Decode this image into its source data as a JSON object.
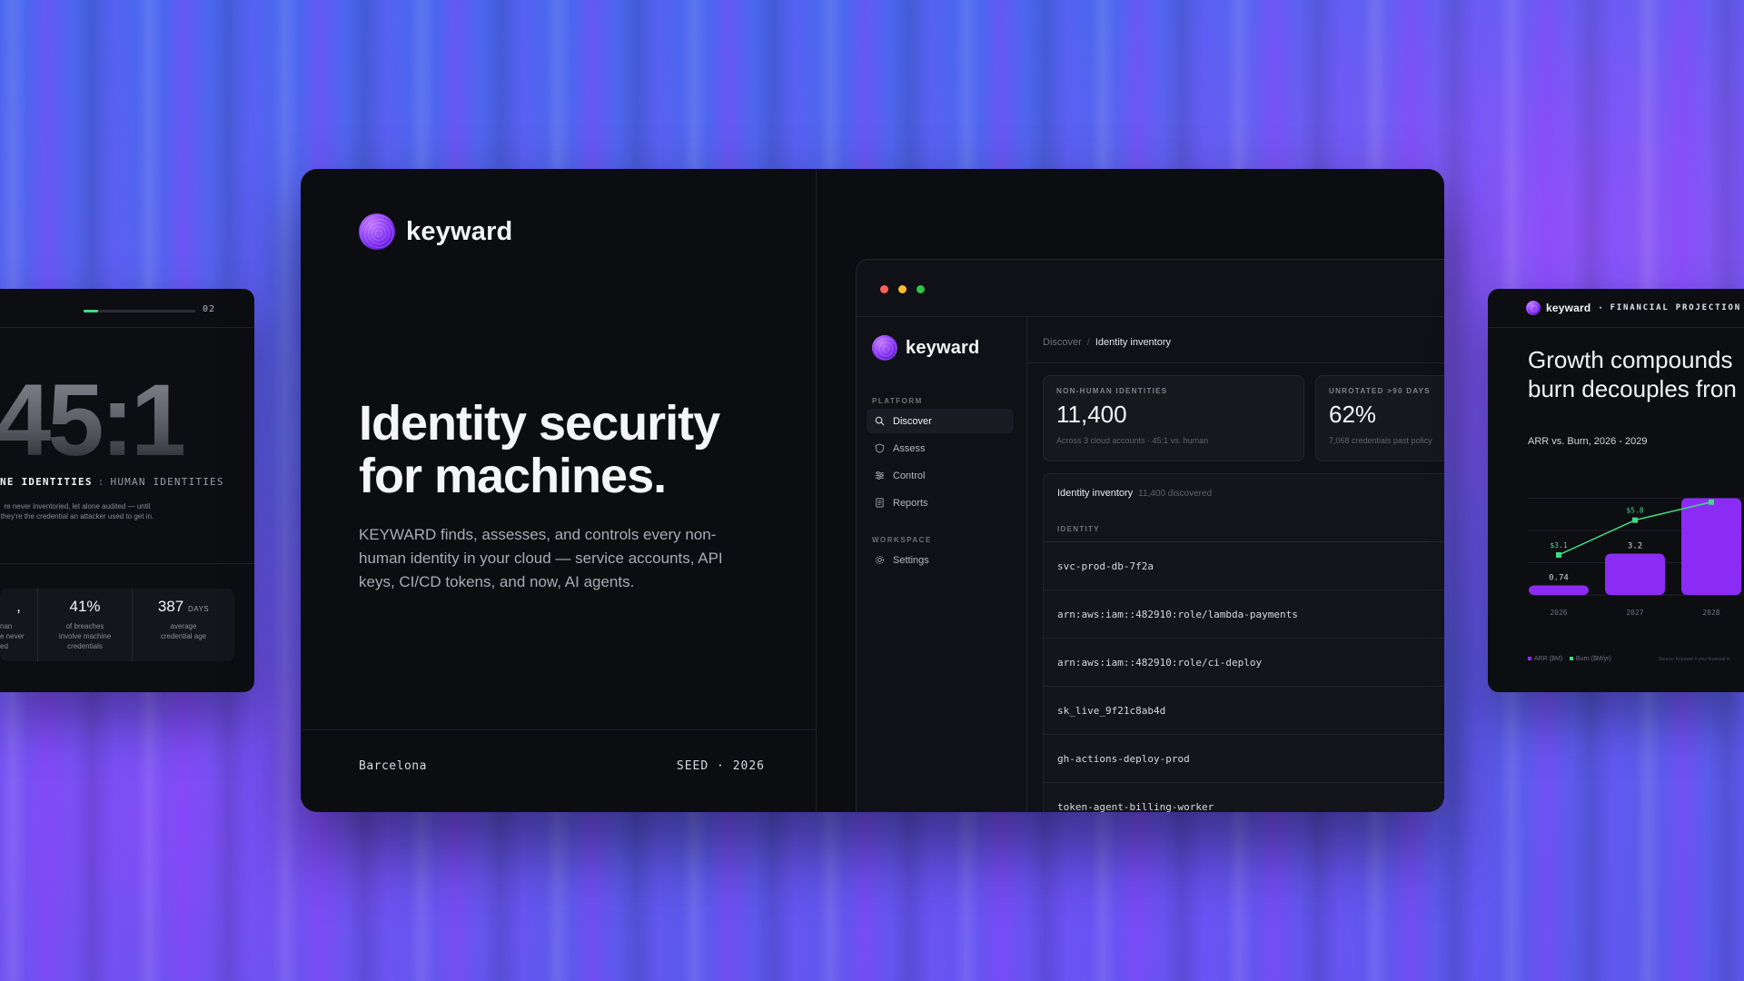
{
  "left_card": {
    "page": "02",
    "progress": 0.13,
    "ratio": "45:1",
    "label_a": "NE IDENTITIES",
    "label_sep": ":",
    "label_b": "HUMAN IDENTITIES",
    "description": "re never inventoried, let alone audited — until they're the credential an attacker used to get in.",
    "stats": [
      {
        "value": ",",
        "unit": "",
        "desc": "nan\ne never\ned"
      },
      {
        "value": "41%",
        "unit": "",
        "desc": "of breaches\ninvolve machine\ncredentials"
      },
      {
        "value": "387",
        "unit": "DAYS",
        "desc": "average\ncredential age"
      }
    ]
  },
  "main": {
    "brand": "keyward",
    "hero_title": "Identity security for machines.",
    "hero_sub": "KEYWARD finds, assesses, and controls every non-human identity in your cloud — service accounts, API keys, CI/CD tokens, and now, AI agents.",
    "footer_city": "Barcelona",
    "footer_seed": "SEED · 2026"
  },
  "app": {
    "window_dots": [
      "#ff5f57",
      "#febc2e",
      "#28c840"
    ],
    "brand": "keyward",
    "sections": {
      "platform": "PLATFORM",
      "workspace": "WORKSPACE"
    },
    "nav": [
      {
        "label": "Discover",
        "icon": "search-icon",
        "active": true
      },
      {
        "label": "Assess",
        "icon": "shield-icon",
        "active": false
      },
      {
        "label": "Control",
        "icon": "sliders-icon",
        "active": false
      },
      {
        "label": "Reports",
        "icon": "document-icon",
        "active": false
      }
    ],
    "settings": {
      "label": "Settings",
      "icon": "gear-icon"
    },
    "breadcrumb": {
      "parent": "Discover",
      "current": "Identity inventory"
    },
    "kpis": [
      {
        "label": "NON-HUMAN IDENTITIES",
        "value": "11,400",
        "note": "Across 3 cloud accounts · 45:1 vs. human"
      },
      {
        "label": "UNROTATED >90 DAYS",
        "value": "62%",
        "note": "7,068 credentials past policy"
      }
    ],
    "table": {
      "title": "Identity inventory",
      "count": "11,400 discovered",
      "column": "IDENTITY",
      "rows": [
        "svc-prod-db-7f2a",
        "arn:aws:iam::482910:role/lambda-payments",
        "arn:aws:iam::482910:role/ci-deploy",
        "sk_live_9f21c8ab4d",
        "gh-actions-deploy-prod",
        "token-agent-billing-worker"
      ]
    }
  },
  "right_card": {
    "brand": "keyward",
    "bullet": "•",
    "header_label": "FINANCIAL PROJECTION",
    "title_line1": "Growth compounds",
    "title_line2": "burn decouples fron",
    "legend_arr": "ARR ($M)",
    "legend_burn": "Burn ($M/yr)",
    "source": "Source: Keyward # your financial m",
    "colors": {
      "arr": "#8b2cf5",
      "burn": "#3ddc84"
    }
  },
  "chart_data": {
    "type": "bar",
    "title": "ARR vs. Burn, 2026 - 2029",
    "categories": [
      "2026",
      "2027",
      "2028"
    ],
    "series": [
      {
        "name": "ARR ($M)",
        "type": "bar",
        "values": [
          0.74,
          3.2,
          7.5
        ]
      },
      {
        "name": "Burn ($M/yr)",
        "type": "line",
        "values": [
          3.1,
          5.8,
          7.2
        ]
      }
    ],
    "data_labels": {
      "arr": [
        "0.74",
        "3.2",
        ""
      ],
      "burn": [
        "$3.1",
        "$5.8",
        ""
      ]
    },
    "ylim": [
      0,
      10
    ],
    "grid": true
  }
}
